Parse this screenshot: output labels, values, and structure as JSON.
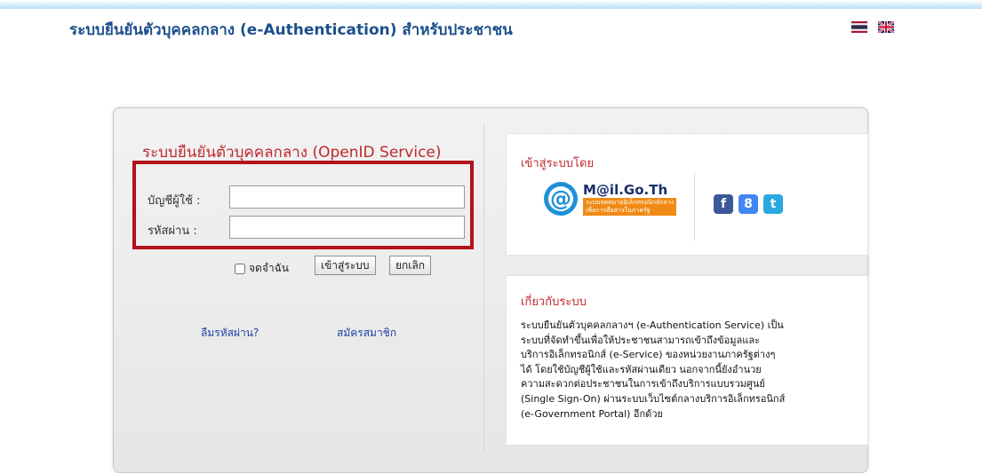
{
  "header": {
    "title": "ระบบยืนยันตัวบุคคลกลาง (e-Authentication) สำหรับประชาชน",
    "flag_th": "thailand-flag-icon",
    "flag_en": "uk-flag-icon"
  },
  "login": {
    "title": "ระบบยืนยันตัวบุคคลกลาง (OpenID Service)",
    "username_label": "บัญชีผู้ใช้ :",
    "password_label": "รหัสผ่าน :",
    "username_value": "",
    "password_value": "",
    "remember_label": "จดจำฉัน",
    "login_button": "เข้าสู่ระบบ",
    "cancel_button": "ยกเลิก",
    "forgot_password": "ลืมรหัสผ่าน?",
    "register": "สมัครสมาชิก"
  },
  "sso": {
    "title": "เข้าสู่ระบบโดย",
    "mail_brand": "M@il.Go.Th",
    "mail_tagline_1": "ระบบจดหมายอิเล็กทรอนิกส์กลาง",
    "mail_tagline_2": "เพื่อการสื่อสารในภาครัฐ",
    "facebook": "f",
    "google": "8",
    "twitter": "t"
  },
  "about": {
    "title": "เกี่ยวกับระบบ",
    "lines": [
      "ระบบยืนยันตัวบุคคลกลางฯ (e-Authentication Service) เป็น",
      "ระบบที่จัดทำขึ้นเพื่อให้ประชาชนสามารถเข้าถึงข้อมูลและ",
      "บริการอิเล็กทรอนิกส์ (e-Service) ของหน่วยงานภาครัฐต่างๆ",
      "ได้ โดยใช้บัญชีผู้ใช้และรหัสผ่านเดียว นอกจากนี้ยังอำนวย",
      "ความสะดวกต่อประชาชนในการเข้าถึงบริการแบบรวมศูนย์",
      "(Single Sign-On) ผ่านระบบเว็บไซต์กลางบริการอิเล็กทรอนิกส์",
      "(e-Government Portal) อีกด้วย"
    ]
  },
  "colors": {
    "header_blue": "#1d4f8c",
    "title_red": "#c0282b",
    "frame_red": "#b2121a",
    "link_blue": "#1c3fa6"
  }
}
